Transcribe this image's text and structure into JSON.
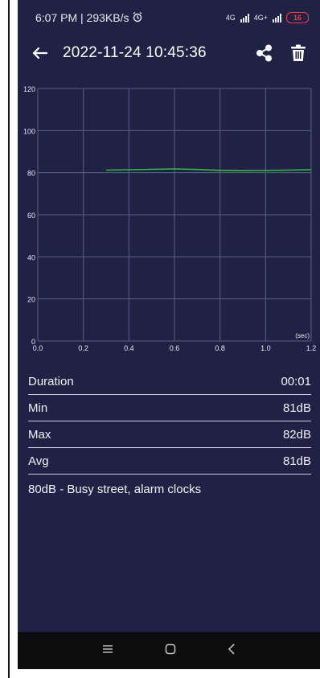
{
  "status_bar": {
    "time_speed": "6:07 PM | 293KB/s",
    "net1": "4G",
    "net2": "4G+",
    "battery": "16"
  },
  "header": {
    "title": "2022-11-24 10:45:36"
  },
  "chart_data": {
    "type": "line",
    "x": [
      0.3,
      0.4,
      0.5,
      0.6,
      0.7,
      0.8,
      0.9,
      1.0,
      1.1,
      1.2
    ],
    "series": [
      {
        "values": [
          81.2,
          81.4,
          81.6,
          81.8,
          81.5,
          81.1,
          80.9,
          81.0,
          81.2,
          81.4
        ]
      }
    ],
    "x_ticks": [
      "0.0",
      "0.2",
      "0.4",
      "0.6",
      "0.8",
      "1.0",
      "1.2"
    ],
    "y_ticks": [
      "0",
      "20",
      "40",
      "60",
      "80",
      "100",
      "120"
    ],
    "xlabel": "(sec)",
    "ylabel": "",
    "xlim": [
      0,
      1.2
    ],
    "ylim": [
      0,
      120
    ],
    "grid": true,
    "line_color": "#2fbf3a"
  },
  "stats": {
    "duration_label": "Duration",
    "duration_value": "00:01",
    "min_label": "Min",
    "min_value": "81dB",
    "max_label": "Max",
    "max_value": "82dB",
    "avg_label": "Avg",
    "avg_value": "81dB"
  },
  "description": "80dB - Busy street, alarm clocks",
  "colors": {
    "background": "#1f2244",
    "grid": "#5a5f86",
    "accent_line": "#2fbf3a"
  }
}
